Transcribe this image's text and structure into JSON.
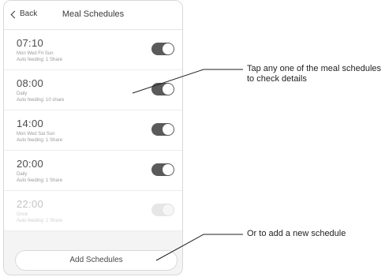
{
  "navbar": {
    "back_label": "Back",
    "title": "Meal Schedules"
  },
  "schedules": [
    {
      "time": "07:10",
      "days": "Mon Wed Fri Sun",
      "feeding": "Auto feeding: 1 Share",
      "enabled": true
    },
    {
      "time": "08:00",
      "days": "Daily",
      "feeding": "Auto feeding: 10 share",
      "enabled": true
    },
    {
      "time": "14:00",
      "days": "Mon Wed Sat Sun",
      "feeding": "Auto feeding: 1 Share",
      "enabled": true
    },
    {
      "time": "20:00",
      "days": "Daily",
      "feeding": "Auto feeding: 1 Share",
      "enabled": true
    },
    {
      "time": "22:00",
      "days": "Once",
      "feeding": "Auto feeding: 1 Share",
      "enabled": false
    }
  ],
  "add_button_label": "Add Schedules",
  "annotations": {
    "details": "Tap any one of the meal schedules to check details",
    "add_new": "Or to add a new schedule"
  }
}
